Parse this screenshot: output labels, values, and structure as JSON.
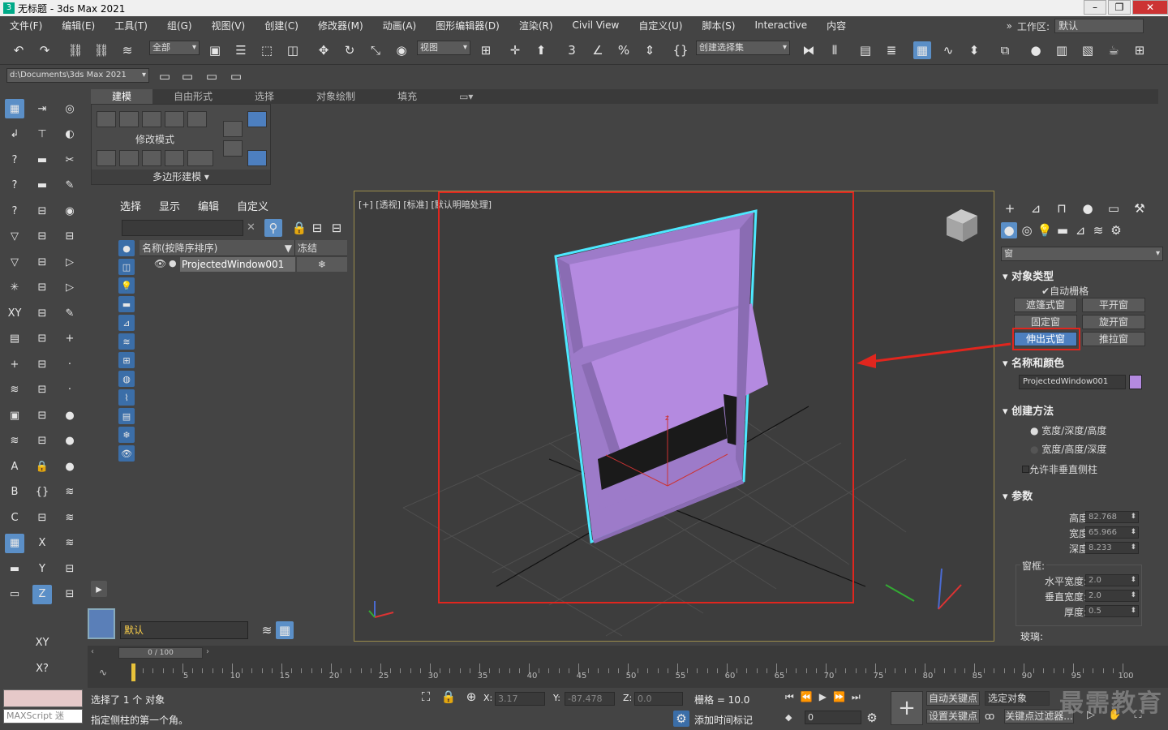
{
  "window": {
    "title": "无标题 - 3ds Max 2021"
  },
  "menu": [
    "文件(F)",
    "编辑(E)",
    "工具(T)",
    "组(G)",
    "视图(V)",
    "创建(C)",
    "修改器(M)",
    "动画(A)",
    "图形编辑器(D)",
    "渲染(R)",
    "Civil View",
    "自定义(U)",
    "脚本(S)",
    "Interactive",
    "内容"
  ],
  "workspace": {
    "label": "工作区:",
    "value": "默认"
  },
  "toolbar": {
    "filter_value": "全部",
    "ref_coord": "视图",
    "selection_set": "创建选择集"
  },
  "project_path": "d:\\Documents\\3ds Max 2021",
  "ribbon": {
    "tabs": [
      "建模",
      "自由形式",
      "选择",
      "对象绘制",
      "填充"
    ],
    "active_tab": "建模",
    "panel_label": "修改模式",
    "panel_footer": "多边形建模"
  },
  "scene_explorer": {
    "tabs": [
      "选择",
      "显示",
      "编辑",
      "自定义"
    ],
    "col_name": "名称(按降序排序)",
    "col_freeze": "冻结",
    "object_name": "ProjectedWindow001",
    "layer_value": "默认"
  },
  "viewport": {
    "label": "[+] [透视] [标准] [默认明暗处理]",
    "axis_z": "z"
  },
  "command_panel": {
    "category_value": "窗",
    "object_type": {
      "title": "对象类型",
      "autogrid": "自动栅格",
      "buttons": [
        "遮篷式窗",
        "平开窗",
        "固定窗",
        "旋开窗",
        "伸出式窗",
        "推拉窗"
      ],
      "selected": "伸出式窗"
    },
    "name_color": {
      "title": "名称和颜色",
      "name": "ProjectedWindow001",
      "color": "#b48ae0"
    },
    "creation_method": {
      "title": "创建方法",
      "options": [
        "宽度/深度/高度",
        "宽度/高度/深度"
      ],
      "checkbox": "允许非垂直侧柱"
    },
    "params": {
      "title": "参数",
      "height_label": "高度:",
      "height": "82.768",
      "width_label": "宽度:",
      "width": "65.966",
      "depth_label": "深度:",
      "depth": "8.233",
      "frame_label": "窗框:",
      "hwidth_label": "水平宽度:",
      "hwidth": "2.0",
      "vwidth_label": "垂直宽度:",
      "vwidth": "2.0",
      "thick_label": "厚度:",
      "thick": "0.5",
      "glass_label": "玻璃:"
    }
  },
  "timeline": {
    "frame_indicator": "0 / 100",
    "ticks": [
      "5",
      "10",
      "15",
      "20",
      "25",
      "30",
      "35",
      "40",
      "45",
      "50",
      "55",
      "60",
      "65",
      "70",
      "75",
      "80",
      "85",
      "90",
      "95",
      "100"
    ]
  },
  "status": {
    "maxscript_placeholder": "MAXScript 迷",
    "selected_text": "选择了 1 个 对象",
    "prompt_text": "指定侧柱的第一个角。",
    "x_label": "X:",
    "x": "3.17",
    "y_label": "Y:",
    "y": "-87.478",
    "z_label": "Z:",
    "z": "0.0",
    "grid": "栅格 = 10.0",
    "add_time_tag": "添加时间标记",
    "frame_field": "0",
    "auto_key": "自动关键点",
    "set_key": "设置关键点",
    "selected_object": "选定对象",
    "key_filters": "关键点过滤器..."
  },
  "watermark": "最需教育",
  "colors": {
    "highlight": "#e0261e",
    "accent_blue": "#4d7fbf",
    "window_purple": "#b48ae0",
    "selection_cyan": "#4de8ff"
  }
}
